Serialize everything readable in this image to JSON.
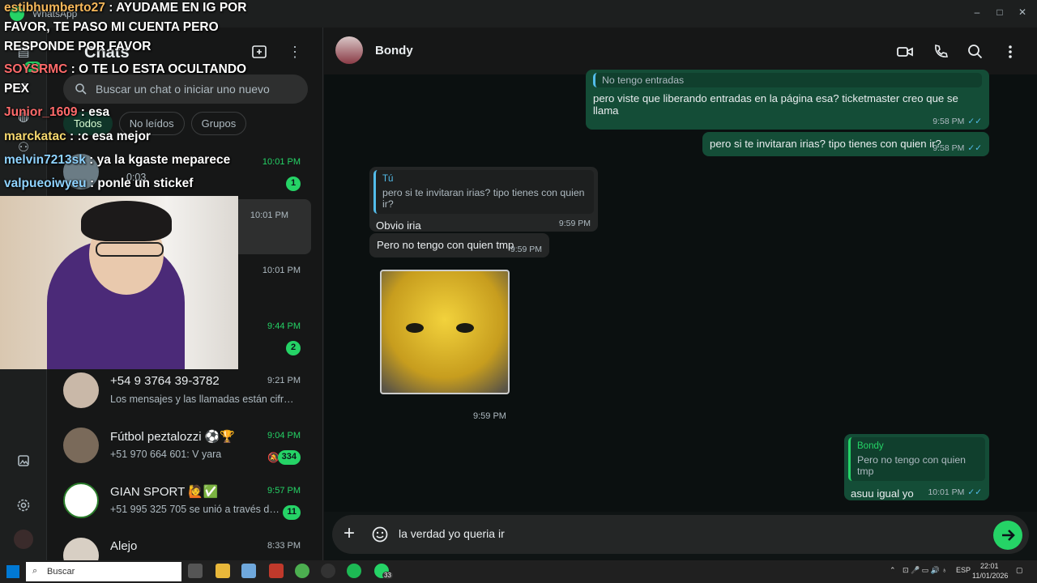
{
  "window": {
    "title": "WhatsApp",
    "minimize": "–",
    "maximize": "□",
    "close": "✕"
  },
  "rail": {
    "chats_badge": "33"
  },
  "sidebar": {
    "title": "Chats",
    "search_placeholder": "Buscar un chat o iniciar uno nuevo",
    "filters": [
      "Todos",
      "No leídos",
      "Grupos"
    ],
    "chats": [
      {
        "name": "",
        "preview": "0:03",
        "time": "10:01 PM",
        "unread": "1"
      },
      {
        "name": "",
        "preview": "",
        "time": "10:01 PM",
        "unread": ""
      },
      {
        "name": "",
        "preview": "",
        "time": "10:01 PM",
        "unread": ""
      },
      {
        "name": "",
        "preview": "",
        "time": "9:44 PM",
        "unread": "2"
      },
      {
        "name": "+54 9 3764 39-3782",
        "preview": "Los mensajes y las llamadas están cifr…",
        "time": "9:21 PM",
        "unread": ""
      },
      {
        "name": "Fútbol peztalozzi ⚽🏆",
        "preview": "+51 970 664 601: V yara",
        "time": "9:04 PM",
        "unread": "334"
      },
      {
        "name": "GIAN SPORT 🙋✅",
        "preview": "+51 995 325 705 se unió a través d…",
        "time": "9:57 PM",
        "unread": "11"
      },
      {
        "name": "Alejo",
        "preview": "",
        "time": "8:33 PM",
        "unread": ""
      }
    ]
  },
  "conversation": {
    "contact": "Bondy",
    "messages": [
      {
        "quote_text": "No tengo entradas",
        "text": "pero viste que liberando entradas en la página esa? ticketmaster creo que se llama",
        "time": "9:58 PM"
      },
      {
        "text": "pero si te invitaran irias? tipo tienes con quien ir?",
        "time": "9:58 PM"
      },
      {
        "quote_author": "Tú",
        "quote_text": "pero si te invitaran irias? tipo tienes con quien ir?",
        "text": "Obvio iria",
        "time": "9:59 PM"
      },
      {
        "text": "Pero no tengo con quien tmp",
        "time": "9:59 PM"
      },
      {
        "sticker_time": "9:59 PM"
      },
      {
        "quote_author": "Bondy",
        "quote_text": "Pero no tengo con quien tmp",
        "text": "asuu igual yo",
        "time": "10:01 PM"
      }
    ],
    "composer_text": "la verdad yo queria ir"
  },
  "stream_chat": [
    {
      "user": "estibhumberto27",
      "msg": " : AYUDAME EN IG POR"
    },
    {
      "user": "",
      "msg": "FAVOR, TE PASO MI CUENTA PERO"
    },
    {
      "user": "",
      "msg": "RESPONDE POR FAVOR"
    },
    {
      "user": "SOYSRMC",
      "msg": " : O TE LO ESTA OCULTANDO"
    },
    {
      "user": "",
      "msg": "PEX"
    },
    {
      "user": "Junior_1609",
      "msg": " : esa"
    },
    {
      "user": "marckatac",
      "msg": " : :c esa mejor"
    },
    {
      "user": "melvin7213sk",
      "msg": " : ya la kgaste meparece"
    },
    {
      "user": "valpueoiwyeu",
      "msg": " : ponle un stickef"
    }
  ],
  "taskbar": {
    "search": "Buscar",
    "lang": "ESP",
    "time": "22:01",
    "date": "11/01/2026",
    "wa_badge": "33"
  },
  "colors": {
    "accent": "#25d366",
    "outgoing": "#144d37",
    "incoming": "#242626",
    "read_ticks": "#53bdeb"
  }
}
